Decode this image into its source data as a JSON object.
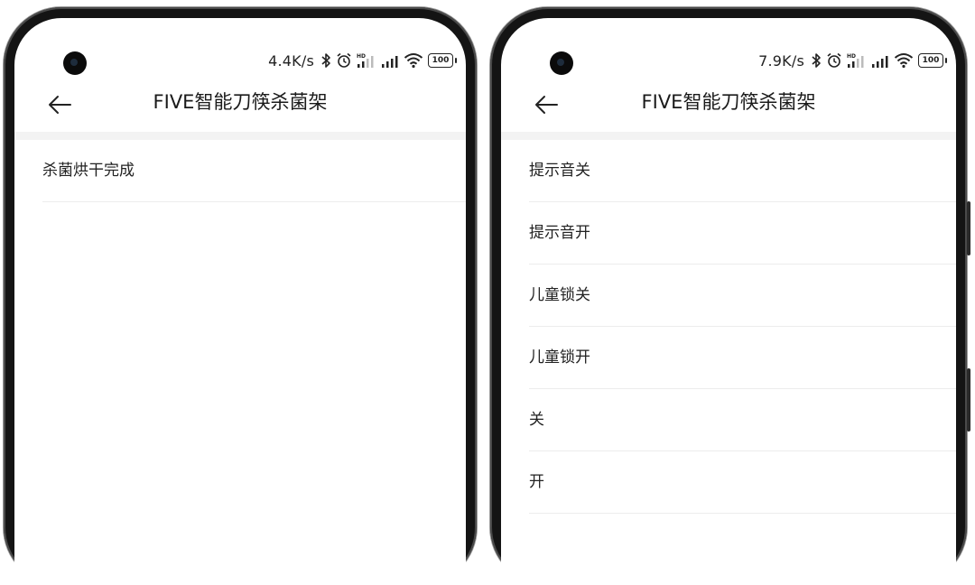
{
  "screens": [
    {
      "status": {
        "net_speed": "4.4K/s",
        "battery": "100",
        "hd_label": "HD"
      },
      "header": {
        "title": "FIVE智能刀筷杀菌架"
      },
      "items": [
        {
          "label": "杀菌烘干完成"
        }
      ]
    },
    {
      "status": {
        "net_speed": "7.9K/s",
        "battery": "100",
        "hd_label": "HD"
      },
      "header": {
        "title": "FIVE智能刀筷杀菌架"
      },
      "items": [
        {
          "label": "提示音关"
        },
        {
          "label": "提示音开"
        },
        {
          "label": "儿童锁关"
        },
        {
          "label": "儿童锁开"
        },
        {
          "label": "关"
        },
        {
          "label": "开"
        }
      ]
    }
  ],
  "icons": [
    "back-arrow-icon",
    "bluetooth-icon",
    "alarm-icon",
    "cellular-signal-icon",
    "wifi-icon",
    "battery-icon"
  ]
}
